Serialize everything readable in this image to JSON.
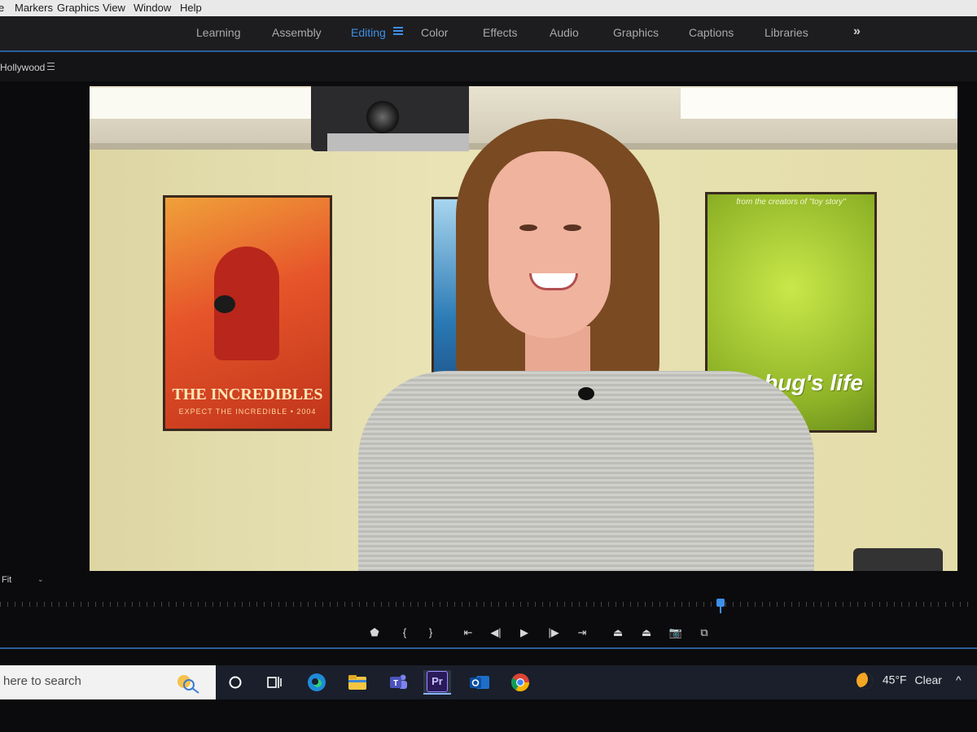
{
  "menu": {
    "items": [
      "e",
      "Markers",
      "Graphics",
      "View",
      "Window",
      "Help"
    ]
  },
  "workspaces": {
    "items": [
      "Learning",
      "Assembly",
      "Editing",
      "Color",
      "Effects",
      "Audio",
      "Graphics",
      "Captions",
      "Libraries"
    ],
    "active": "Editing",
    "overflow_icon": "double-chevron-right-icon",
    "accent_color": "#3d8fe8"
  },
  "panel": {
    "name": "Hollywood",
    "menu_icon": "hamburger-icon"
  },
  "monitor": {
    "posters": {
      "incredibles_title": "THE INCREDIBLES",
      "incredibles_tagline": "EXPECT THE INCREDIBLE • 2004",
      "bugs_header": "from the creators of \"toy story\"",
      "bugs_title": "a bug's life"
    },
    "zoom": "Fit",
    "playhead_position": 0.74
  },
  "transport": {
    "buttons": [
      {
        "name": "add-marker-button",
        "glyph": "⬟"
      },
      {
        "name": "mark-in-button",
        "glyph": "{"
      },
      {
        "name": "mark-out-button",
        "glyph": "}"
      },
      {
        "name": "go-to-in-button",
        "glyph": "⇤"
      },
      {
        "name": "step-back-button",
        "glyph": "◀|"
      },
      {
        "name": "play-button",
        "glyph": "▶"
      },
      {
        "name": "step-forward-button",
        "glyph": "|▶"
      },
      {
        "name": "go-to-out-button",
        "glyph": "⇥"
      },
      {
        "name": "lift-button",
        "glyph": "⏏"
      },
      {
        "name": "extract-button",
        "glyph": "⏏"
      },
      {
        "name": "export-frame-button",
        "glyph": "📷"
      },
      {
        "name": "comparison-view-button",
        "glyph": "⧉"
      }
    ]
  },
  "taskbar": {
    "search_placeholder": "here to search",
    "apps": [
      "cortana",
      "task-view",
      "edge",
      "file-explorer",
      "teams",
      "premiere-pro",
      "outlook",
      "chrome"
    ],
    "premiere_label": "Pr",
    "weather_temp": "45°F",
    "weather_desc": "Clear",
    "tray_chevron": "^"
  }
}
